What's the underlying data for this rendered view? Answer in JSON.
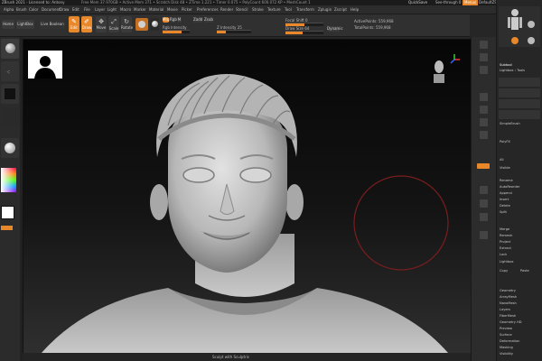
{
  "titlebar": {
    "app_title": "ZBrush 2021 - Licensed to: Antony",
    "mesh_info": "Free Mem 37.970GB • Active Mem 371 • Scratch Disk 48 • ZTime 1.221 • Timer 0.075 • PolyCount 600.072 KP • MeshCount 1",
    "quicksave": "QuickSave",
    "see_through": "See-through 0",
    "menus_label": "Menus",
    "default_script": "DefaultZScript"
  },
  "menubar": {
    "items": [
      "Alpha",
      "Brush",
      "Color",
      "Document",
      "Draw",
      "Edit",
      "File",
      "Layer",
      "Light",
      "Macro",
      "Marker",
      "Material",
      "Movie",
      "Picker",
      "Preferences",
      "Render",
      "Stencil",
      "Stroke",
      "Texture",
      "Tool",
      "Transform",
      "Zplugin",
      "Zscript",
      "Help"
    ]
  },
  "toolshelf": {
    "buttons": [
      "Home",
      "LightBox",
      "Live Boolean"
    ],
    "edit_label": "Edit",
    "draw_label": "Draw",
    "move_label": "Move",
    "scale_label": "Scale",
    "rotate_label": "Rotate",
    "mrgb_label": "Mrgb",
    "rgb_label": "Rgb",
    "m_label": "M",
    "zadd_label": "Zadd",
    "zsub_label": "Zsub",
    "rgb_intensity_label": "Rgb Intensity",
    "z_intensity_label": "Z Intensity 25",
    "focal_shift_label": "Focal Shift 0",
    "draw_size_label": "Draw Size 64",
    "dynamic_label": "Dynamic",
    "active_points_label": "ActivePoints: 559,968",
    "total_points_label": "TotalPoints: 559,968",
    "z_intensity": 0.25,
    "focal_shift": 0.5,
    "draw_size": 0.45,
    "rgb_intensity": 0.7
  },
  "rightpanel": {
    "subtool_label": "Subtool",
    "lightbox_label": "Lightbox › Tools",
    "items": [
      "Geometry",
      "ArrayMesh",
      "NanoMesh",
      "Layers",
      "FiberMesh",
      "Geometry HD",
      "Preview",
      "Surface",
      "Deformation",
      "Masking",
      "Visibility"
    ],
    "mid_items": [
      "SimpleBrush",
      "Make PolyMesh3D",
      "GoZ",
      "All",
      "Visible",
      "R",
      "Spl",
      "Merge",
      "Remesh",
      "Project",
      "Extract",
      "Lock",
      "Subtool",
      "Rename",
      "AutoReorder",
      "Append",
      "Insert",
      "Delete",
      "Split",
      "Morph Target",
      "Polypaint",
      "UV Map"
    ],
    "polyfx_label": "PolyFX",
    "lightbox_btn": "Lightbox",
    "copy_label": "Copy",
    "paste_label": "Paste"
  },
  "statusbar": {
    "text": "Sculpt with Sculptris"
  },
  "colors": {
    "accent": "#e8882a",
    "background": "#262626",
    "canvas_top": "#060606",
    "model": "#c9c9c9"
  },
  "icons": [
    "dynamesh-icon",
    "brush-sphere-icon",
    "stroke-dots-icon",
    "alpha-square-icon",
    "material-sphere-icon",
    "color-picker-icon",
    "switch-color-icon",
    "camera-icon",
    "frame-icon",
    "move-icon",
    "zoom-icon",
    "rotate-icon",
    "transp-icon",
    "ghost-icon",
    "solo-icon",
    "xpose-icon",
    "floor-icon",
    "local-icon"
  ]
}
